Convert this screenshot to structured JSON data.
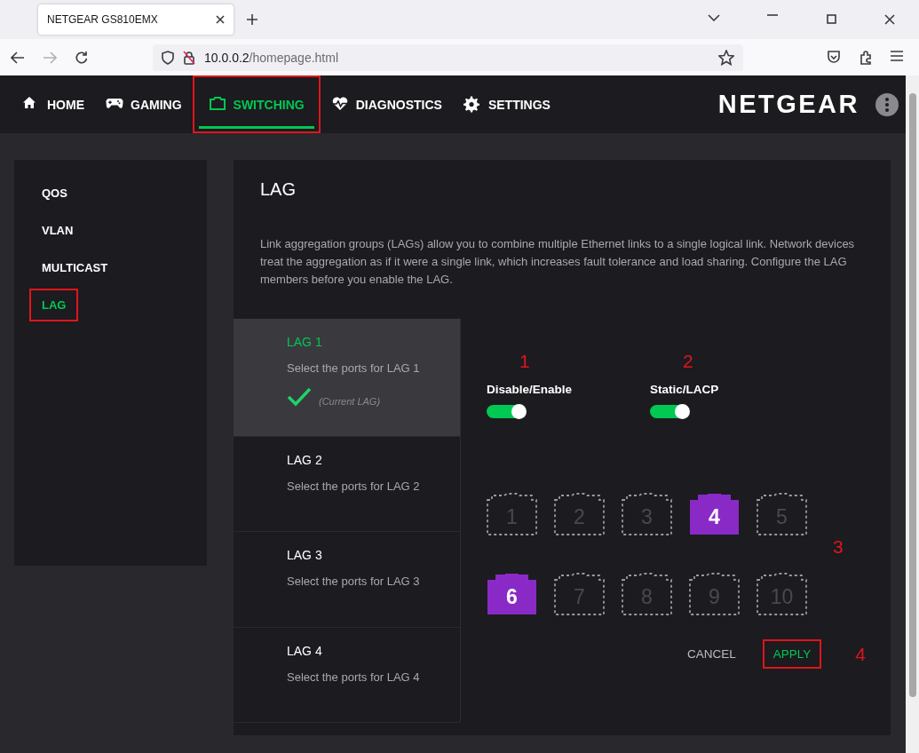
{
  "browser": {
    "tab_title": "NETGEAR GS810EMX",
    "url_host": "10.0.0.2",
    "url_path": "/homepage.html"
  },
  "nav": {
    "items": [
      {
        "label": "HOME",
        "selected": false,
        "highlighted": false
      },
      {
        "label": "GAMING",
        "selected": false,
        "highlighted": false
      },
      {
        "label": "SWITCHING",
        "selected": true,
        "highlighted": true
      },
      {
        "label": "DIAGNOSTICS",
        "selected": false,
        "highlighted": false
      },
      {
        "label": "SETTINGS",
        "selected": false,
        "highlighted": false
      }
    ],
    "logo": "NETGEAR"
  },
  "sidebar": {
    "items": [
      {
        "label": "QOS",
        "selected": false,
        "highlighted": false
      },
      {
        "label": "VLAN",
        "selected": false,
        "highlighted": false
      },
      {
        "label": "MULTICAST",
        "selected": false,
        "highlighted": false
      },
      {
        "label": "LAG",
        "selected": true,
        "highlighted": true
      }
    ]
  },
  "lag": {
    "title": "LAG",
    "description": "Link aggregation groups (LAGs) allow you to combine multiple Ethernet links to a single logical link. Network devices treat the aggregation as if it were a single link, which increases fault tolerance and load sharing. Configure the LAG members before you enable the LAG.",
    "groups": [
      {
        "name": "LAG 1",
        "subtitle": "Select the ports for LAG 1",
        "selected": true,
        "status": "(Current LAG)"
      },
      {
        "name": "LAG 2",
        "subtitle": "Select the ports for LAG 2",
        "selected": false
      },
      {
        "name": "LAG 3",
        "subtitle": "Select the ports for LAG 3",
        "selected": false
      },
      {
        "name": "LAG 4",
        "subtitle": "Select the ports for LAG 4",
        "selected": false
      }
    ],
    "toggles": [
      {
        "label": "Disable/Enable",
        "on": true,
        "annotation": "1"
      },
      {
        "label": "Static/LACP",
        "on": true,
        "annotation": "2"
      }
    ],
    "ports": [
      {
        "label": "1",
        "selected": false
      },
      {
        "label": "2",
        "selected": false
      },
      {
        "label": "3",
        "selected": false
      },
      {
        "label": "4",
        "selected": true
      },
      {
        "label": "5",
        "selected": false
      },
      {
        "label": "6",
        "selected": true
      },
      {
        "label": "7",
        "selected": false
      },
      {
        "label": "8",
        "selected": false
      },
      {
        "label": "9",
        "selected": false
      },
      {
        "label": "10",
        "selected": false
      }
    ],
    "ports_annotation": "3",
    "buttons": [
      {
        "label": "CANCEL",
        "kind": "secondary",
        "highlighted": false
      },
      {
        "label": "APPLY",
        "kind": "primary",
        "highlighted": true
      }
    ],
    "buttons_annotation": "4"
  }
}
